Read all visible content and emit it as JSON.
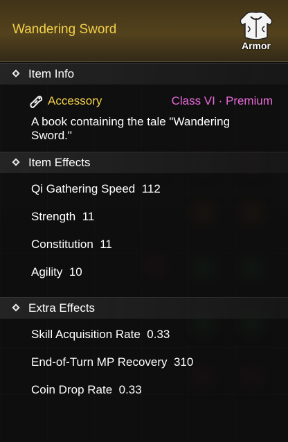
{
  "item": {
    "name": "Wandering Sword",
    "type_badge": "Armor",
    "category": "Accessory",
    "class_info": "Class VI · Premium",
    "description": "A book containing the tale \"Wandering Sword.\""
  },
  "sections": {
    "item_info": "Item Info",
    "item_effects": "Item Effects",
    "extra_effects": "Extra Effects"
  },
  "item_effects": [
    {
      "label": "Qi Gathering Speed",
      "value": "112"
    },
    {
      "label": "Strength",
      "value": "11"
    },
    {
      "label": "Constitution",
      "value": "11"
    },
    {
      "label": "Agility",
      "value": "10"
    }
  ],
  "extra_effects": [
    {
      "label": "Skill Acquisition Rate",
      "value": "0.33"
    },
    {
      "label": "End-of-Turn MP Recovery",
      "value": "310"
    },
    {
      "label": "Coin Drop Rate",
      "value": "0.33"
    }
  ],
  "icons": {
    "category_icon": "accessory-scroll-icon",
    "badge_icon": "armor-icon",
    "bullet_icon": "diamond-bullet-icon"
  },
  "colors": {
    "title": "#f2d04a",
    "category": "#f2d04a",
    "class_info": "#e86ad8",
    "text": "#ffffff"
  }
}
